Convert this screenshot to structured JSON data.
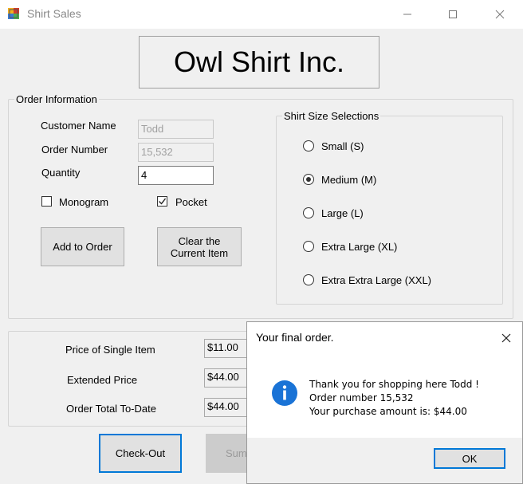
{
  "window": {
    "title": "Shirt Sales",
    "icon": "winforms-app-icon",
    "controls": [
      "minimize-icon",
      "maximize-icon",
      "close-icon"
    ]
  },
  "banner": {
    "text": "Owl Shirt Inc."
  },
  "order_info": {
    "legend": "Order Information",
    "customer_name_label": "Customer Name",
    "customer_name_value": "Todd",
    "order_number_label": "Order Number",
    "order_number_value": "15,532",
    "quantity_label": "Quantity",
    "quantity_value": "4",
    "monogram_label": "Monogram",
    "monogram_checked": false,
    "pocket_label": "Pocket",
    "pocket_checked": true,
    "add_button": "Add to Order",
    "clear_button_line1": "Clear the",
    "clear_button_line2": "Current Item"
  },
  "sizes": {
    "legend": "Shirt Size Selections",
    "options": [
      {
        "label": "Small (S)",
        "selected": false
      },
      {
        "label": "Medium (M)",
        "selected": true
      },
      {
        "label": "Large (L)",
        "selected": false
      },
      {
        "label": "Extra Large (XL)",
        "selected": false
      },
      {
        "label": "Extra Extra Large (XXL)",
        "selected": false
      }
    ]
  },
  "totals": {
    "price_label": "Price of Single Item",
    "price_value": "$11.00",
    "extended_label": "Extended Price",
    "extended_value": "$44.00",
    "total_label": "Order Total To-Date",
    "total_value": "$44.00"
  },
  "actions": {
    "checkout_button": "Check-Out",
    "summary_button": "Sum"
  },
  "dialog": {
    "title": "Your final order.",
    "icon": "info-icon",
    "line1": "Thank you for shopping here Todd !",
    "line2": "Order number 15,532",
    "line3": "Your purchase amount is: $44.00",
    "ok_button": "OK"
  },
  "colors": {
    "window_bg": "#f0f0f0",
    "accent_blue": "#0078d7",
    "info_blue": "#1a73d6"
  }
}
